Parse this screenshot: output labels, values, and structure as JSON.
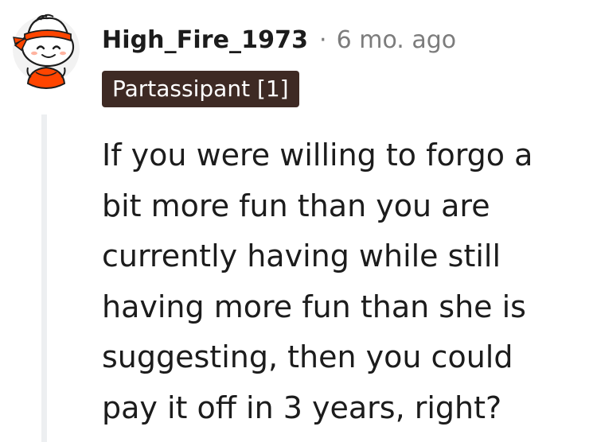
{
  "comment": {
    "author": "High_Fire_1973",
    "separator": "·",
    "timestamp": "6 mo. ago",
    "flair": "Partassipant [1]",
    "body_lines": [
      "If you were willing to forgo a",
      "bit more fun than you are",
      "currently having while still",
      "having more fun than she is",
      "suggesting, then you could",
      "pay it off in 3 years, right?"
    ]
  },
  "colors": {
    "flair_background": "#3e2a24",
    "flair_text": "#ffffff",
    "avatar_headband": "#ff4500",
    "avatar_background": "#f2f2f2",
    "meta_text": "#7c7c7c",
    "thread_line": "#edeff1"
  },
  "icons": {
    "avatar": "snoo-avatar-icon"
  }
}
